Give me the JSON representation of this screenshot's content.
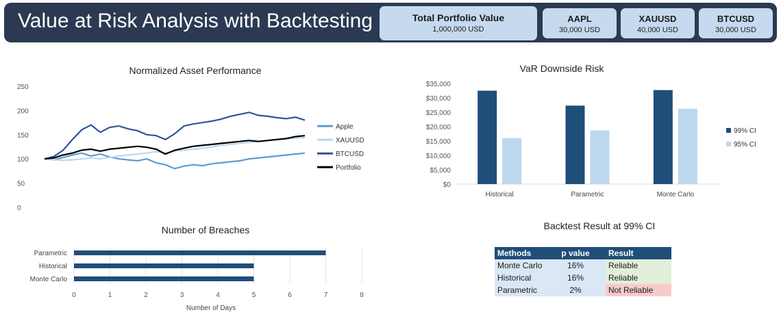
{
  "header": {
    "title": "Value at Risk Analysis with Backtesting",
    "total": {
      "label": "Total Portfolio Value",
      "value": "1,000,000 USD"
    },
    "assets": [
      {
        "label": "AAPL",
        "value": "30,000 USD"
      },
      {
        "label": "XAUUSD",
        "value": "40,000 USD"
      },
      {
        "label": "BTCUSD",
        "value": "30,000 USD"
      }
    ]
  },
  "colors": {
    "header_bg": "#2b3a52",
    "card_bg": "#c5daef",
    "dark_blue": "#1f4e79",
    "light_blue": "#bdd7ee",
    "reliable": "#e2efd9",
    "not_reliable": "#f8cbcb"
  },
  "chart_data": [
    {
      "type": "line",
      "title": "Normalized Asset Performance",
      "ylim": [
        0,
        250
      ],
      "yticks": [
        "250",
        "200",
        "150",
        "100",
        "50",
        "0"
      ],
      "grid": false,
      "legend_position": "right",
      "series": [
        {
          "name": "Apple",
          "color": "#5b9bd5",
          "values": [
            100,
            98,
            103,
            108,
            112,
            106,
            110,
            104,
            100,
            98,
            96,
            100,
            92,
            88,
            80,
            85,
            88,
            86,
            90,
            92,
            94,
            96,
            100,
            102,
            104,
            106,
            108,
            110,
            112
          ]
        },
        {
          "name": "XAUUSD",
          "color": "#bdd7ee",
          "values": [
            100,
            98,
            97,
            98,
            100,
            102,
            100,
            103,
            106,
            108,
            110,
            112,
            115,
            112,
            116,
            118,
            120,
            122,
            125,
            128,
            130,
            132,
            134,
            136,
            138,
            140,
            142,
            143,
            144
          ]
        },
        {
          "name": "BTCUSD",
          "color": "#2f5597",
          "values": [
            100,
            105,
            118,
            140,
            160,
            170,
            155,
            165,
            168,
            162,
            158,
            150,
            148,
            140,
            152,
            168,
            172,
            175,
            178,
            182,
            188,
            192,
            196,
            190,
            188,
            185,
            183,
            186,
            180
          ]
        },
        {
          "name": "Portfolio",
          "color": "#000000",
          "values": [
            100,
            102,
            108,
            112,
            118,
            120,
            116,
            120,
            122,
            124,
            126,
            124,
            120,
            110,
            118,
            122,
            126,
            128,
            130,
            132,
            134,
            136,
            138,
            136,
            138,
            140,
            142,
            146,
            148
          ]
        }
      ]
    },
    {
      "type": "bar",
      "title": "VaR Downside  Risk",
      "categories": [
        "Historical",
        "Parametric",
        "Monte Carlo"
      ],
      "ylim": [
        0,
        35000
      ],
      "yticks": [
        "$35,000",
        "$30,000",
        "$25,000",
        "$20,000",
        "$15,000",
        "$10,000",
        "$5,000",
        "$0"
      ],
      "legend_position": "right",
      "series": [
        {
          "name": "99% CI",
          "color": "#1f4e79",
          "values": [
            32500,
            27300,
            32700
          ]
        },
        {
          "name": "95% CI",
          "color": "#bdd7ee",
          "values": [
            16000,
            18700,
            26200
          ]
        }
      ]
    },
    {
      "type": "bar",
      "orientation": "horizontal",
      "title": "Number of Breaches",
      "categories": [
        "Parametric",
        "Historical",
        "Monte Carlo"
      ],
      "values": [
        7,
        5,
        5
      ],
      "xlim": [
        0,
        8
      ],
      "xticks": [
        "0",
        "1",
        "2",
        "3",
        "4",
        "5",
        "6",
        "7",
        "8"
      ],
      "xlabel": "Number of Days",
      "grid": true
    },
    {
      "type": "table",
      "title": "Backtest Result at 99% CI",
      "columns": [
        "Methods",
        "p value",
        "Result"
      ],
      "rows": [
        {
          "method": "Monte Carlo",
          "p": "16%",
          "result": "Reliable",
          "status": "ok"
        },
        {
          "method": "Historical",
          "p": "16%",
          "result": "Reliable",
          "status": "ok"
        },
        {
          "method": "Parametric",
          "p": "2%",
          "result": "Not Reliable",
          "status": "bad"
        }
      ]
    }
  ]
}
